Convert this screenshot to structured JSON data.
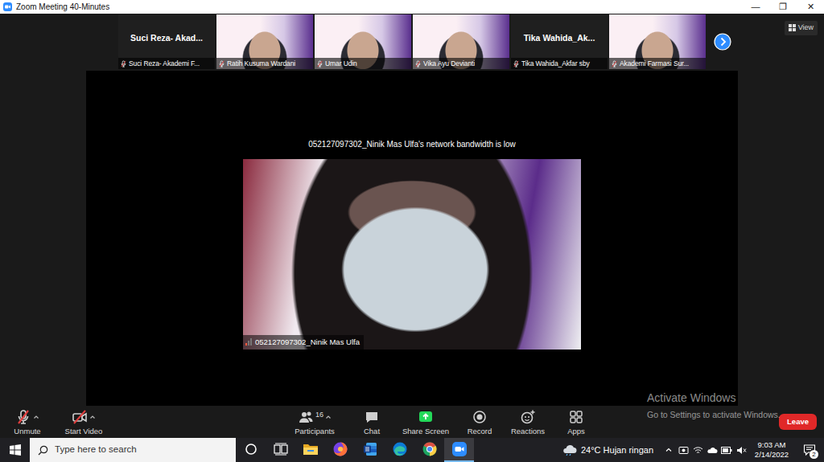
{
  "window": {
    "title": "Zoom Meeting 40-Minutes",
    "controls": [
      "—",
      "❐",
      "✕"
    ]
  },
  "view_button": {
    "label": "View"
  },
  "gallery": {
    "tiles": [
      {
        "kind": "name",
        "name": "Suci Reza- Akad...",
        "label": "Suci Reza- Akademi F...",
        "muted": true
      },
      {
        "kind": "video",
        "label": "Ratih Kusuma Wardani",
        "muted": true
      },
      {
        "kind": "video",
        "label": "Umar Udin",
        "muted": true
      },
      {
        "kind": "video",
        "label": "Vika Ayu Devianti",
        "muted": true
      },
      {
        "kind": "name",
        "name": "Tika Wahida_Ak...",
        "label": "Tika Wahida_Akfar sby",
        "muted": true
      },
      {
        "kind": "video",
        "label": "Akademi Farmasi Sur...",
        "muted": true
      }
    ]
  },
  "stage": {
    "notice": "052127097302_Ninik Mas Ulfa's network bandwidth is low",
    "speaker": {
      "label": "052127097302_Ninik Mas Ulfa",
      "signal_level": 0.33
    }
  },
  "toolbar": {
    "items": [
      {
        "kind": "mic",
        "label": "Unmute",
        "off": true
      },
      {
        "kind": "camera",
        "label": "Start Video",
        "off": true
      },
      {
        "kind": "participants",
        "label": "Participants",
        "count": "16",
        "off": false
      },
      {
        "kind": "chat",
        "label": "Chat",
        "off": false
      },
      {
        "kind": "share",
        "label": "Share Screen",
        "off": false
      },
      {
        "kind": "record",
        "label": "Record",
        "off": false
      },
      {
        "kind": "reactions",
        "label": "Reactions",
        "off": false
      },
      {
        "kind": "apps",
        "label": "Apps",
        "off": false
      }
    ],
    "leave": {
      "label": "Leave"
    }
  },
  "watermark": {
    "title": "Activate Windows",
    "subtitle": "Go to Settings to activate Windows."
  },
  "taskbar": {
    "search": {
      "placeholder": "Type here to search"
    },
    "apps": [
      {
        "kind": "cortana",
        "selected": false
      },
      {
        "kind": "taskview",
        "selected": false
      },
      {
        "kind": "explorer",
        "selected": false
      },
      {
        "kind": "firefox",
        "selected": false
      },
      {
        "kind": "word",
        "selected": false
      },
      {
        "kind": "edge",
        "selected": false
      },
      {
        "kind": "chrome",
        "selected": false
      },
      {
        "kind": "zoom",
        "selected": true
      }
    ],
    "weather": "24°C Hujan ringan",
    "time": "9:03 AM",
    "date": "2/14/2022",
    "notifications": "2"
  }
}
